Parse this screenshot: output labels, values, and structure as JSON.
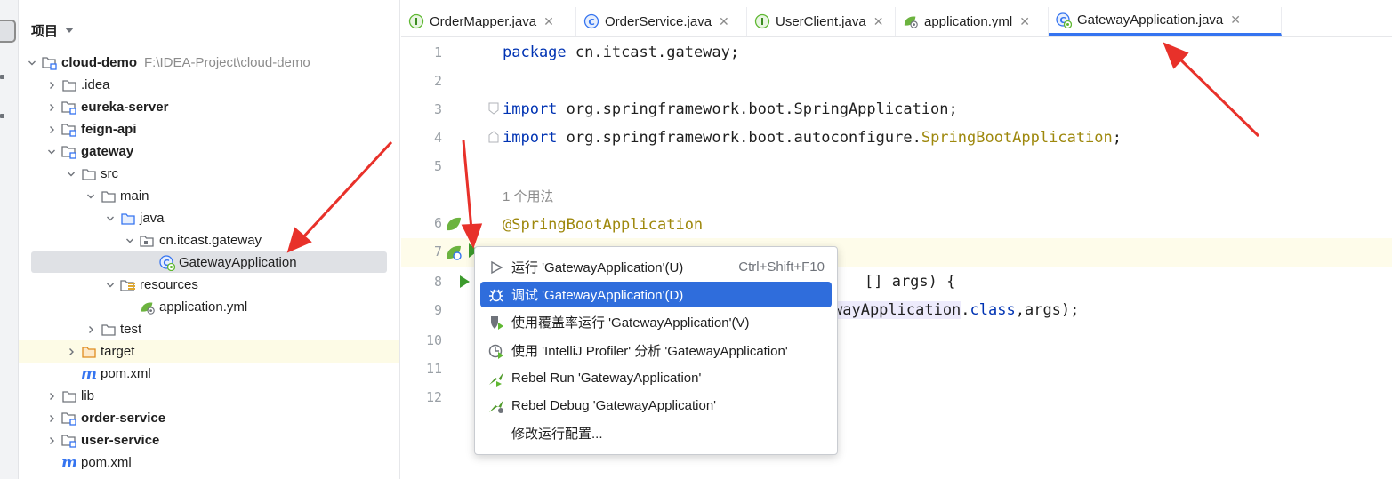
{
  "project_panel": {
    "title": "项目",
    "tree": [
      {
        "label": "cloud-demo",
        "path": "F:\\IDEA-Project\\cloud-demo",
        "bold": true,
        "indent": 0,
        "chevron": "down",
        "icon": "module-folder-icon"
      },
      {
        "label": ".idea",
        "indent": 1,
        "chevron": "right",
        "icon": "folder-icon"
      },
      {
        "label": "eureka-server",
        "bold": true,
        "indent": 1,
        "chevron": "right",
        "icon": "module-folder-icon"
      },
      {
        "label": "feign-api",
        "bold": true,
        "indent": 1,
        "chevron": "right",
        "icon": "module-folder-icon"
      },
      {
        "label": "gateway",
        "bold": true,
        "indent": 1,
        "chevron": "down",
        "icon": "module-folder-icon"
      },
      {
        "label": "src",
        "indent": 2,
        "chevron": "down",
        "icon": "folder-icon"
      },
      {
        "label": "main",
        "indent": 3,
        "chevron": "down",
        "icon": "folder-icon"
      },
      {
        "label": "java",
        "indent": 4,
        "chevron": "down",
        "icon": "source-folder-icon"
      },
      {
        "label": "cn.itcast.gateway",
        "indent": 5,
        "chevron": "down",
        "icon": "package-icon"
      },
      {
        "label": "GatewayApplication",
        "indent": 6,
        "chevron": "none",
        "icon": "spring-class-icon",
        "selected": true
      },
      {
        "label": "resources",
        "indent": 4,
        "chevron": "down",
        "icon": "resources-folder-icon"
      },
      {
        "label": "application.yml",
        "indent": 5,
        "chevron": "none",
        "icon": "spring-yml-icon"
      },
      {
        "label": "test",
        "indent": 3,
        "chevron": "right",
        "icon": "folder-icon"
      },
      {
        "label": "target",
        "indent": 2,
        "chevron": "right",
        "icon": "excluded-folder-icon",
        "highlight": true
      },
      {
        "label": "pom.xml",
        "indent": 2,
        "chevron": "none",
        "icon": "maven-icon"
      },
      {
        "label": "lib",
        "indent": 1,
        "chevron": "right",
        "icon": "folder-icon"
      },
      {
        "label": "order-service",
        "bold": true,
        "indent": 1,
        "chevron": "right",
        "icon": "module-folder-icon"
      },
      {
        "label": "user-service",
        "bold": true,
        "indent": 1,
        "chevron": "right",
        "icon": "module-folder-icon"
      },
      {
        "label": "pom.xml",
        "indent": 1,
        "chevron": "none",
        "icon": "maven-icon"
      }
    ]
  },
  "tabs": [
    {
      "label": "OrderMapper.java",
      "icon": "interface-icon"
    },
    {
      "label": "OrderService.java",
      "icon": "class-icon"
    },
    {
      "label": "UserClient.java",
      "icon": "interface-icon"
    },
    {
      "label": "application.yml",
      "icon": "spring-yml-icon"
    },
    {
      "label": "GatewayApplication.java",
      "icon": "spring-class-icon",
      "active": true
    }
  ],
  "editor": {
    "line_numbers": [
      "1",
      "2",
      "3",
      "4",
      "5",
      "6",
      "7",
      "8",
      "9",
      "10",
      "11",
      "12"
    ],
    "lines": [
      {
        "parts": [
          {
            "t": "package",
            "c": "kw"
          },
          {
            "t": " cn.itcast.gateway;"
          }
        ]
      },
      {
        "parts": []
      },
      {
        "parts": [
          {
            "t": "import",
            "c": "kw"
          },
          {
            "t": " org.springframework.boot.SpringApplication;"
          }
        ]
      },
      {
        "parts": [
          {
            "t": "import",
            "c": "kw"
          },
          {
            "t": " org.springframework.boot.autoconfigure."
          },
          {
            "t": "SpringBootApplication",
            "c": "ann"
          },
          {
            "t": ";"
          }
        ]
      },
      {
        "parts": []
      },
      {
        "parts": [
          {
            "t": "1 个用法",
            "c": "hint"
          }
        ]
      },
      {
        "parts": [
          {
            "t": "@SpringBootApplication",
            "c": "ann"
          }
        ]
      },
      {
        "parts": []
      },
      {
        "parts": [
          {
            "t": "[] args) {"
          }
        ]
      },
      {
        "parts": [
          {
            "t": "wayApplication",
            "c": "cls-bg"
          },
          {
            "t": "."
          },
          {
            "t": "class",
            "c": "kw"
          },
          {
            "t": ",args);"
          }
        ]
      }
    ]
  },
  "context_menu": {
    "items": [
      {
        "label": "运行 'GatewayApplication'(U)",
        "shortcut": "Ctrl+Shift+F10",
        "icon": "run-icon"
      },
      {
        "label": "调试 'GatewayApplication'(D)",
        "shortcut": "",
        "icon": "debug-icon",
        "selected": true
      },
      {
        "label": "使用覆盖率运行  'GatewayApplication'(V)",
        "shortcut": "",
        "icon": "coverage-icon"
      },
      {
        "label": "使用 'IntelliJ Profiler' 分析  'GatewayApplication'",
        "shortcut": "",
        "icon": "profiler-icon"
      },
      {
        "label": "Rebel Run 'GatewayApplication'",
        "shortcut": "",
        "icon": "rebel-run-icon"
      },
      {
        "label": "Rebel Debug 'GatewayApplication'",
        "shortcut": "",
        "icon": "rebel-debug-icon"
      },
      {
        "label": "修改运行配置...",
        "shortcut": "",
        "icon": ""
      }
    ]
  },
  "colors": {
    "accent": "#3574f0",
    "selection": "#2f6ddc",
    "annotation": "#9e880d",
    "keyword": "#0033b3",
    "arrow": "#e8312a"
  }
}
